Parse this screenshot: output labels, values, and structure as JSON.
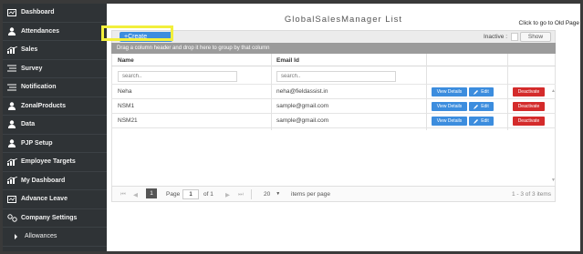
{
  "sidebar": {
    "items": [
      {
        "label": "Dashboard",
        "icon": "dashboard-icon"
      },
      {
        "label": "Attendances",
        "icon": "user-icon"
      },
      {
        "label": "Sales",
        "icon": "chart-icon"
      },
      {
        "label": "Survey",
        "icon": "list-icon"
      },
      {
        "label": "Notification",
        "icon": "list-icon"
      },
      {
        "label": "ZonalProducts",
        "icon": "user-icon"
      },
      {
        "label": "Data",
        "icon": "user-icon"
      },
      {
        "label": "PJP Setup",
        "icon": "user-icon"
      },
      {
        "label": "Employee Targets",
        "icon": "chart-icon"
      },
      {
        "label": "My Dashboard",
        "icon": "chart-icon"
      },
      {
        "label": "Advance Leave",
        "icon": "dashboard-icon"
      },
      {
        "label": "Company Settings",
        "icon": "settings-icon"
      },
      {
        "label": "Allowances",
        "icon": "chevron-right-icon"
      }
    ]
  },
  "header": {
    "title": "GlobalSalesManager List",
    "old_page_link": "Click to go to Old Page"
  },
  "toolbar": {
    "create_label": "+Create",
    "inactive_label": "Inactive :",
    "show_label": "Show"
  },
  "grid": {
    "group_hint": "Drag a column header and drop it here to group by that column",
    "columns": [
      "Name",
      "Email Id"
    ],
    "filter_placeholders": [
      "search..",
      "search.."
    ],
    "rows": [
      {
        "name": "Neha",
        "email": "neha@fieldassist.in"
      },
      {
        "name": "NSM1",
        "email": "sample@gmail.com"
      },
      {
        "name": "NSM21",
        "email": "sample@gmail.com"
      }
    ],
    "actions": {
      "view": "View Details",
      "edit": "Edit",
      "deactivate": "Deactivate"
    }
  },
  "pager": {
    "current_page": "1",
    "page_label": "Page",
    "page_value": "1",
    "of_label": "of 1",
    "page_size": "20",
    "per_page_label": "items per page",
    "summary": "1 - 3 of 3 items"
  },
  "colors": {
    "sidebar_bg": "#2f3336",
    "accent_blue": "#3c8dde",
    "danger_red": "#d42b2b",
    "highlight_yellow": "#f2ef3c"
  }
}
